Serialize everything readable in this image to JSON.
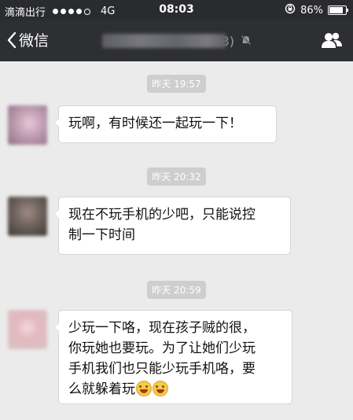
{
  "status_bar": {
    "carrier": "滴滴出行",
    "network": "4G",
    "time": "08:03",
    "battery": "86%",
    "battery_level": 0.86
  },
  "nav": {
    "back_label": "微信",
    "title_suffix": "3)"
  },
  "messages": [
    {
      "timestamp": "昨天 19:57",
      "text": "玩啊，有时候还一起玩一下！"
    },
    {
      "timestamp": "昨天 20:32",
      "text_lines": [
        "现在不玩手机的少吧，只能说控",
        "制一下时间"
      ]
    },
    {
      "timestamp": "昨天 20:59",
      "text_lines": [
        "少玩一下咯，现在孩子贼的很，",
        "你玩她也要玩。为了让她们少玩",
        "手机我们也只能少玩手机咯，要",
        "么就躲着玩"
      ],
      "emoji": [
        "laughing-crying",
        "laughing-crying"
      ]
    }
  ],
  "colors": {
    "status_bg": "#2a2b2f",
    "nav_bg": "#2e2f33",
    "chat_bg": "#ebebeb",
    "bubble_bg": "#ffffff",
    "timestamp_bg": "#cecece"
  }
}
